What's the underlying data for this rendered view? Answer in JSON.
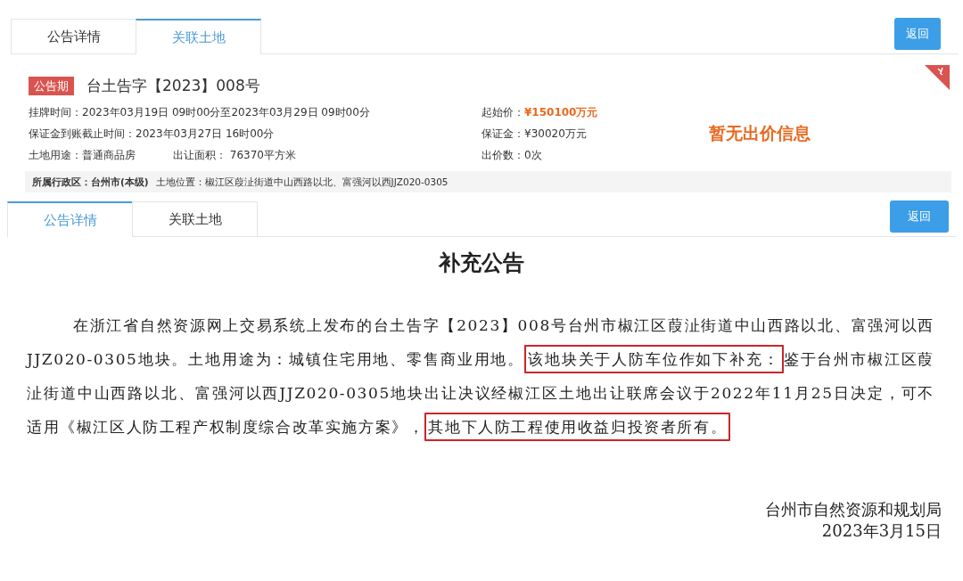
{
  "listing_panel": {
    "tabs": [
      {
        "label": "公告详情",
        "selected": false
      },
      {
        "label": "关联土地",
        "selected": true
      }
    ],
    "back_button": "返回",
    "listing": {
      "status_badge": "公告期",
      "title": "台土告字【2023】008号",
      "left_lines": [
        "挂牌时间：2023年03月19日 09时00分至2023年03月29日 09时00分",
        "保证金到账截止时间：2023年03月27日 16时00分",
        "土地用途：普通商品房"
      ],
      "area": "出让面积： 76370平方米",
      "price_fields": [
        {
          "label": "起始价：",
          "value": "¥150100万元",
          "kind": "highlight"
        },
        {
          "label": "保证金：",
          "value": "¥30020万元",
          "kind": "plain"
        },
        {
          "label": "出价数：",
          "value": "0次",
          "kind": "plain"
        }
      ],
      "bid_notice": "暂无出价信息",
      "district": "所属行政区：台州市(本级)",
      "location": "土地位置：椒江区葭沚街道中山西路以北、富强河以西JJZ020-0305"
    }
  },
  "notice_panel": {
    "tabs": [
      {
        "label": "公告详情",
        "selected": true
      },
      {
        "label": "关联土地",
        "selected": false
      }
    ],
    "back_button": "返回",
    "document": {
      "title": "补充公告",
      "paragraph": [
        {
          "text": "在浙江省自然资源网上交易系统上发布的台土告字【2023】008号台州市椒江区葭沚街道中山西路以北、富强河以西JJZ020-0305地块。土地用途为：城镇住宅用地、零售商业用地。",
          "boxed": false
        },
        {
          "text": "该地块关于人防车位作如下补充：",
          "boxed": true
        },
        {
          "text": "鉴于台州市椒江区葭沚街道中山西路以北、富强河以西JJZ020-0305地块出让决议经椒江区土地出让联席会议于2022年11月25日决定，可不适用《椒江区人防工程产权制度综合改革实施方案》，",
          "boxed": false
        },
        {
          "text": "其地下人防工程使用收益归投资者所有。",
          "boxed": true
        }
      ],
      "issuer": "台州市自然资源和规划局",
      "date": "2023年3月15日"
    }
  }
}
